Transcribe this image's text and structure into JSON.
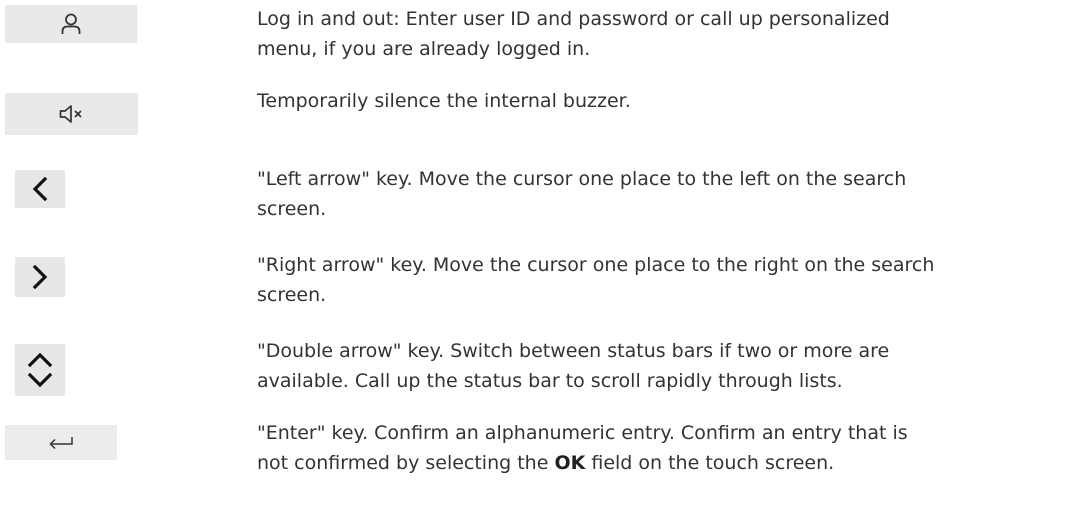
{
  "keys": [
    {
      "icon": "user-icon",
      "line1": "Log in and out: Enter user ID and password or call up personalized",
      "line2": "menu, if you are already logged in."
    },
    {
      "icon": "mute-speaker-icon",
      "line1": "Temporarily silence the internal buzzer.",
      "line2": ""
    },
    {
      "icon": "left-arrow-icon",
      "line1": "\"Left arrow\" key. Move the cursor one place to the left on the search",
      "line2": "screen."
    },
    {
      "icon": "right-arrow-icon",
      "line1": "\"Right arrow\" key. Move the cursor one place to the right on the search",
      "line2": "screen."
    },
    {
      "icon": "double-arrow-icon",
      "line1": "\"Double arrow\" key. Switch between status bars if two or more are",
      "line2": "available. Call up the status bar to scroll rapidly through lists."
    },
    {
      "icon": "enter-icon",
      "line1": "\"Enter\" key. Confirm an alphanumeric entry. Confirm an entry that is",
      "line2_before": "not confirmed by selecting the ",
      "line2_bold": "OK",
      "line2_after": " field on the touch screen."
    }
  ]
}
